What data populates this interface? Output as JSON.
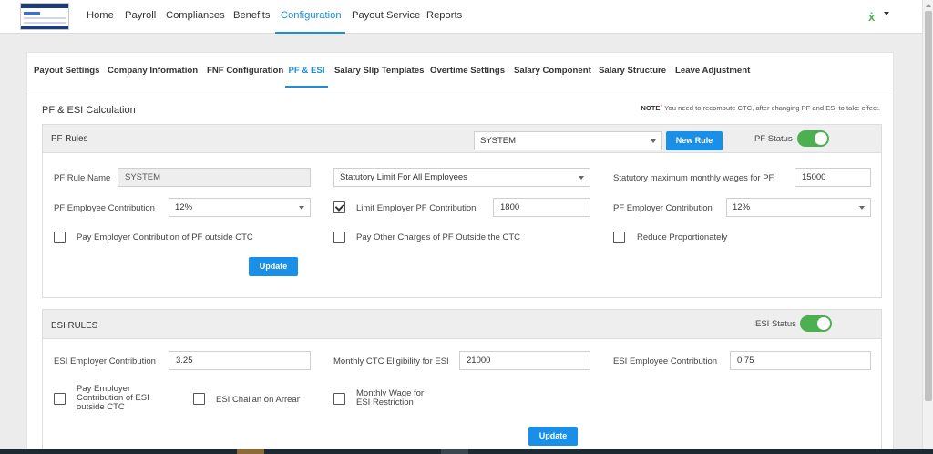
{
  "nav": {
    "items": [
      "Home",
      "Payroll",
      "Compliances",
      "Benefits",
      "Configuration",
      "Payout Service",
      "Reports"
    ],
    "active_index": 4
  },
  "tabs": {
    "items": [
      "Payout Settings",
      "Company Information",
      "FNF Configuration",
      "PF & ESI",
      "Salary Slip Templates",
      "Overtime Settings",
      "Salary Component",
      "Salary Structure",
      "Leave Adjustment"
    ],
    "active_index": 3
  },
  "page": {
    "title": "PF & ESI Calculation",
    "note_label": "NOTE",
    "note_star": "*",
    "note_text": " You need to recompute CTC, after changing PF and ESI to take effect."
  },
  "pf": {
    "title": "PF Rules",
    "rule_select": "SYSTEM",
    "new_rule_button": "New Rule",
    "status_label": "PF Status",
    "status_on": true,
    "rule_name_label": "PF Rule Name",
    "rule_name_value": "SYSTEM",
    "statutory_limit_select": "Statutory Limit For All Employees",
    "max_wages_label": "Statutory maximum monthly wages for PF",
    "max_wages_value": "15000",
    "employee_contribution_label": "PF Employee Contribution",
    "employee_contribution_value": "12%",
    "limit_employer_label": "Limit Employer PF Contribution",
    "limit_employer_checked": true,
    "limit_employer_value": "1800",
    "employer_contribution_label": "PF Employer Contribution",
    "employer_contribution_value": "12%",
    "pay_employer_outside_label": "Pay Employer Contribution of PF outside CTC",
    "pay_other_charges_label": "Pay Other Charges of PF Outside the CTC",
    "reduce_prop_label": "Reduce Proportionately",
    "update_button": "Update"
  },
  "esi": {
    "title": "ESI RULES",
    "status_label": "ESI Status",
    "status_on": true,
    "employer_contribution_label": "ESI Employer Contribution",
    "employer_contribution_value": "3.25",
    "monthly_ctc_label": "Monthly CTC Eligibility for ESI",
    "monthly_ctc_value": "21000",
    "employee_contribution_label": "ESI Employee Contribution",
    "employee_contribution_value": "0.75",
    "pay_employer_outside_line1": "Pay Employer",
    "pay_employer_outside_line2": "Contribution of ESI",
    "pay_employer_outside_line3": "outside CTC",
    "challan_label": "ESI Challan on Arrear",
    "monthly_wage_line1": "Monthly Wage for",
    "monthly_wage_line2": "ESI Restriction",
    "update_button": "Update"
  },
  "colors": {
    "accent": "#1a8fd6",
    "button": "#1a8fe8",
    "toggle_on": "#4caf50"
  }
}
